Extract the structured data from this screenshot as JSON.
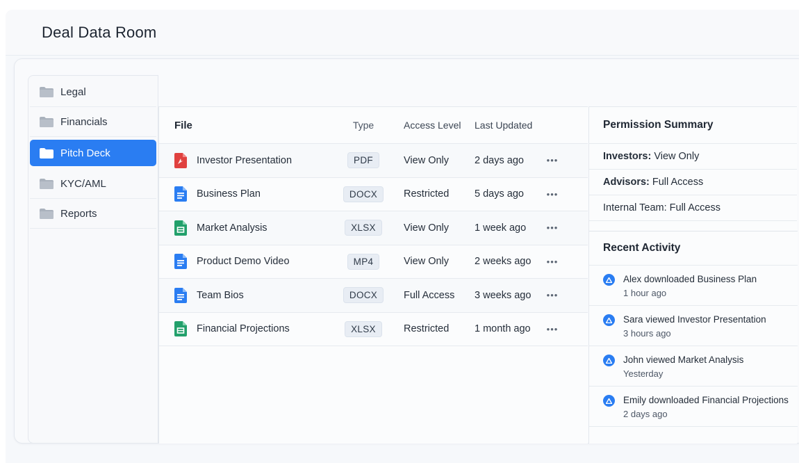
{
  "window": {
    "title": "Deal Data Room"
  },
  "sidebar": {
    "items": [
      {
        "label": "Legal",
        "active": false
      },
      {
        "label": "Financials",
        "active": false
      },
      {
        "label": "Pitch Deck",
        "active": true
      },
      {
        "label": "KYC/AML",
        "active": false
      },
      {
        "label": "Reports",
        "active": false
      }
    ]
  },
  "table": {
    "headers": {
      "file": "File",
      "type": "Type",
      "access": "Access Level",
      "updated": "Last Updated"
    },
    "more_glyph": "•••",
    "rows": [
      {
        "name": "Investor Presentation",
        "icon": "pdf-icon",
        "type": "PDF",
        "access": "View Only",
        "updated": "2 days ago"
      },
      {
        "name": "Business Plan",
        "icon": "doc-icon",
        "type": "DOCX",
        "access": "Restricted",
        "updated": "5 days ago"
      },
      {
        "name": "Market Analysis",
        "icon": "sheet-icon",
        "type": "XLSX",
        "access": "View Only",
        "updated": "1 week ago"
      },
      {
        "name": "Product Demo Video",
        "icon": "doc-icon",
        "type": "MP4",
        "access": "View Only",
        "updated": "2 weeks ago"
      },
      {
        "name": "Team Bios",
        "icon": "doc-icon",
        "type": "DOCX",
        "access": "Full Access",
        "updated": "3 weeks ago"
      },
      {
        "name": "Financial Projections",
        "icon": "sheet-icon",
        "type": "XLSX",
        "access": "Restricted",
        "updated": "1 month ago"
      }
    ]
  },
  "permissions": {
    "title": "Permission Summary",
    "rows": [
      {
        "role": "Investors:",
        "value": "View Only"
      },
      {
        "role": "Advisors:",
        "value": "Full Access"
      },
      {
        "role": "",
        "value": "Internal Team: Full Access"
      }
    ]
  },
  "activity": {
    "title": "Recent Activity",
    "items": [
      {
        "text": "Alex downloaded Business Plan",
        "time": "1 hour ago"
      },
      {
        "text": "Sara viewed Investor Presentation",
        "time": "3 hours ago"
      },
      {
        "text": "John viewed Market Analysis",
        "time": "Yesterday"
      },
      {
        "text": "Emily downloaded Financial Projections",
        "time": "2 days ago"
      }
    ]
  },
  "colors": {
    "accent": "#2a7df2",
    "pdf": "#e0413f",
    "doc": "#2a7df2",
    "sheet": "#22a06b",
    "folder": "#aab2bd"
  }
}
